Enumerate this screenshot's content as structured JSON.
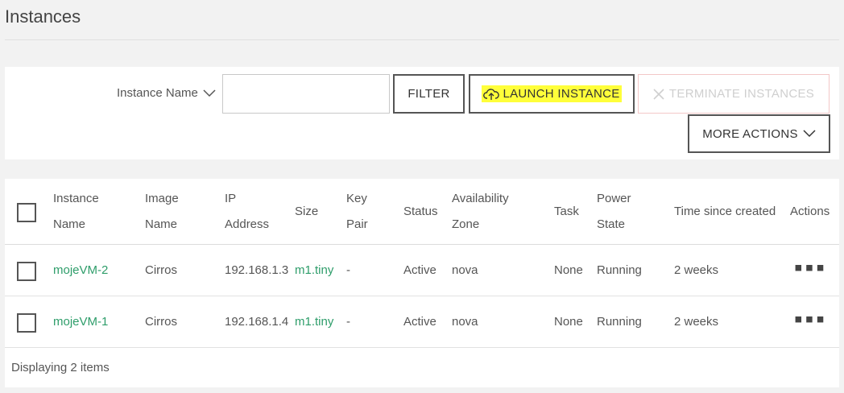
{
  "page": {
    "title": "Instances"
  },
  "toolbar": {
    "filter_field_label": "Instance Name",
    "filter_value": "",
    "filter_button": "FILTER",
    "launch_button": "LAUNCH INSTANCE",
    "terminate_button": "TERMINATE INSTANCES",
    "more_actions_button": "MORE ACTIONS"
  },
  "table": {
    "headers": {
      "instance_name": [
        "Instance",
        "Name"
      ],
      "image_name": [
        "Image",
        "Name"
      ],
      "ip_address": [
        "IP",
        "Address"
      ],
      "size": "Size",
      "key_pair": [
        "Key",
        "Pair"
      ],
      "status": "Status",
      "availability_zone": [
        "Availability",
        "Zone"
      ],
      "task": "Task",
      "power_state": [
        "Power",
        "State"
      ],
      "time_since_created": "Time since created",
      "actions": "Actions"
    },
    "rows": [
      {
        "name": "mojeVM-2",
        "image": "Cirros",
        "ip": "192.168.1.3",
        "size": "m1.tiny",
        "key_pair": "-",
        "status": "Active",
        "zone": "nova",
        "task": "None",
        "power_state": "Running",
        "created": "2 weeks",
        "actions": "▪▪▪"
      },
      {
        "name": "mojeVM-1",
        "image": "Cirros",
        "ip": "192.168.1.4",
        "size": "m1.tiny",
        "key_pair": "-",
        "status": "Active",
        "zone": "nova",
        "task": "None",
        "power_state": "Running",
        "created": "2 weeks",
        "actions": "▪▪▪"
      }
    ],
    "footer": "Displaying 2 items"
  },
  "colors": {
    "link": "#2e9d6a",
    "highlight": "#ffff3a",
    "border": "#555555"
  },
  "icons": {
    "filter_dropdown": "chevron-down-icon",
    "launch": "cloud-upload-icon",
    "terminate": "close-icon",
    "more": "chevron-down-icon",
    "row_actions": "more-dots-icon"
  }
}
